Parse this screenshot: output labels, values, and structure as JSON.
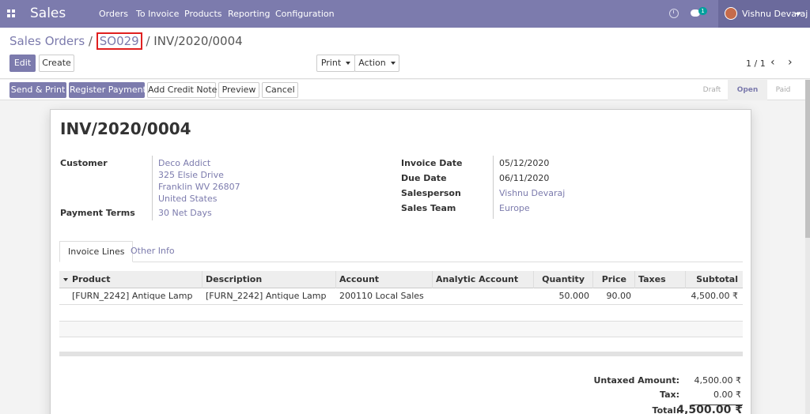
{
  "navbar": {
    "app_title": "Sales",
    "menu": [
      "Orders",
      "To Invoice",
      "Products",
      "Reporting",
      "Configuration"
    ],
    "chat_count": "1",
    "user_name": "Vishnu Devaraj"
  },
  "breadcrumb": {
    "root": "Sales Orders",
    "sep1": " / ",
    "order": "SO029",
    "sep2": " / ",
    "current": "INV/2020/0004"
  },
  "toolbar": {
    "edit": "Edit",
    "create": "Create",
    "print": "Print",
    "action": "Action",
    "pager": "1 / 1"
  },
  "statusbar": {
    "buttons": [
      "Send & Print",
      "Register Payment",
      "Add Credit Note",
      "Preview",
      "Cancel"
    ],
    "stages": [
      "Draft",
      "Open",
      "Paid"
    ],
    "active_stage": "Open"
  },
  "invoice": {
    "title": "INV/2020/0004",
    "customer_label": "Customer",
    "customer_lines": [
      "Deco Addict",
      "325 Elsie Drive",
      "Franklin WV 26807",
      "United States"
    ],
    "payment_terms_label": "Payment Terms",
    "payment_terms": "30 Net Days",
    "invoice_date_label": "Invoice Date",
    "invoice_date": "05/12/2020",
    "due_date_label": "Due Date",
    "due_date": "06/11/2020",
    "salesperson_label": "Salesperson",
    "salesperson": "Vishnu Devaraj",
    "sales_team_label": "Sales Team",
    "sales_team": "Europe"
  },
  "tabs": [
    "Invoice Lines",
    "Other Info"
  ],
  "table": {
    "headers": [
      "Product",
      "Description",
      "Account",
      "Analytic Account",
      "Quantity",
      "Price",
      "Taxes",
      "Subtotal"
    ],
    "rows": [
      [
        "[FURN_2242] Antique Lamp",
        "[FURN_2242] Antique Lamp",
        "200110 Local Sales",
        "",
        "50.000",
        "90.00",
        "",
        "4,500.00 ₹"
      ]
    ]
  },
  "totals": {
    "untaxed_label": "Untaxed Amount:",
    "untaxed": "4,500.00 ₹",
    "tax_label": "Tax:",
    "tax": "0.00 ₹",
    "total_label": "Total:",
    "total": "4,500.00 ₹"
  },
  "colors": {
    "brand": "#7c7bad",
    "highlight_box": "#e02020"
  }
}
